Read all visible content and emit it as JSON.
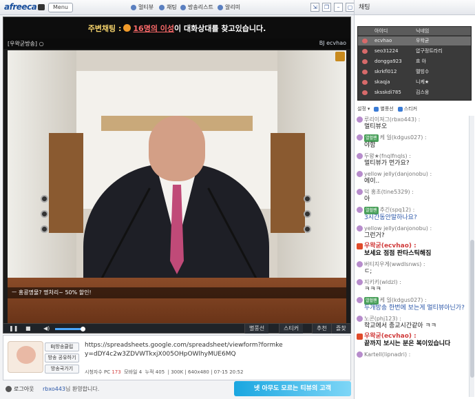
{
  "app": {
    "logo": "afreeca",
    "menu_label": "Menu"
  },
  "topnav": [
    {
      "label": "멀티뷰",
      "icon": "multiview-icon"
    },
    {
      "label": "채팅",
      "icon": "chat-icon"
    },
    {
      "label": "방송리스트",
      "icon": "list-icon"
    },
    {
      "label": "알리미",
      "icon": "alarm-icon"
    }
  ],
  "ticker": {
    "lead": "주변채팅 :",
    "highlight": "16명의 이성",
    "rest": "이 대화상대를 찾고있습니다."
  },
  "broadcast": {
    "title": "[우왁굳방송] ○",
    "bj_label": "BJ ecvhao",
    "subtitle": "ㅡ 홍콩명물? 명처리~ 50% 할인!"
  },
  "controls": {
    "volume": 0.9,
    "tabs": [
      "별풍선",
      "스티커",
      "추천",
      "즐찾"
    ]
  },
  "info": {
    "bj_buttons": [
      "BJ방송클립",
      "방송 공유하기",
      "방송국가기"
    ],
    "url": "https://spreadsheets.google.com/spreadsheet/viewform?formkey=dDY4c2w3ZDVWTkxjX005OHpOWlhyMUE6MQ",
    "stats": {
      "viewers_label": "시청자수",
      "pc_label": "PC",
      "pc": "173",
      "mobile_label": "모바일",
      "mobile": "4",
      "total_label": "누적",
      "total": "405",
      "bitrate": "300K",
      "resolution": "640x480",
      "time": "07-15 20:52"
    }
  },
  "footer": {
    "logout_label": "로그아웃",
    "welcome_nick": "rbxo443",
    "welcome_suffix": "님 환영합니다.",
    "banner_text": "넷 아무도 모르는 티뷰의 고객"
  },
  "chat": {
    "header": "채팅",
    "columns": {
      "id": "아이디",
      "nick": "닉네임"
    },
    "users": [
      {
        "id": "ecvhao",
        "nick": "우왁굳"
      },
      {
        "id": "seo31224",
        "nick": "압구정트라리"
      },
      {
        "id": "dongga923",
        "nick": "흐 아"
      },
      {
        "id": "skrkfl012",
        "nick": "멜빙수"
      },
      {
        "id": "skaqja",
        "nick": "니케★"
      },
      {
        "id": "sksskdi785",
        "nick": "김스웅"
      }
    ],
    "tools": [
      "설정",
      "별풍선",
      "스티커"
    ],
    "messages": [
      {
        "type": "normal",
        "sender": "루리이져그(rbxo443) :",
        "text": "멀티뷰오"
      },
      {
        "type": "fan",
        "badge": "열혈팬",
        "sender": "케 일(kdgus027) :",
        "text": "야함"
      },
      {
        "type": "normal",
        "sender": "두왕★(fnqlfnqls) :",
        "text": "멀티뷰가 먼가요?"
      },
      {
        "type": "normal",
        "sender": "yellow jelly(danjonobu) :",
        "text": "에이.."
      },
      {
        "type": "normal",
        "sender": "덕 홍초(tine5329) :",
        "text": "아"
      },
      {
        "type": "fan blue",
        "badge": "열혈팬",
        "sender": "추긴(spq12) :",
        "text": "3시간동안말하나요?"
      },
      {
        "type": "normal",
        "sender": "yellow jelly(danjonobu) :",
        "text": "그런거?"
      },
      {
        "type": "bj",
        "sender": "우왁굳(ecvhao) :",
        "text": "보세요 점점 판타스틱해짐"
      },
      {
        "type": "normal",
        "sender": "버티지우게(wwdlsnws) :",
        "text": "ㄷ;"
      },
      {
        "type": "normal",
        "sender": "지키키(wldzl) :",
        "text": "ㅋㅋㅋ"
      },
      {
        "type": "fan blue",
        "badge": "열혈팬",
        "sender": "케 일(kdgus027) :",
        "text": "두개방송 한번에 보는게 멀티뷰아닌가?"
      },
      {
        "type": "normal",
        "sender": "노콘(phj123) :",
        "text": "학교에서 종교시간같아 ㅋㅋ"
      },
      {
        "type": "bj",
        "sender": "우왁굳(ecvhao) :",
        "text": "끝까지 보시는 분은 복이있습니다"
      },
      {
        "type": "normal",
        "sender": "Kartell(lipnadri) :",
        "text": ""
      }
    ]
  }
}
